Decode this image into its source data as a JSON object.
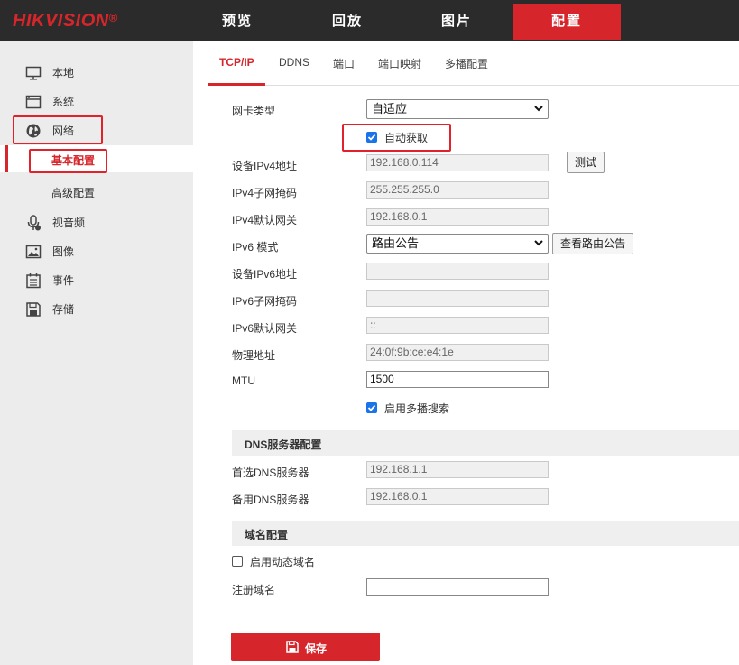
{
  "app": {
    "logo": "HIKVISION",
    "logo_mark": "®"
  },
  "topnav": {
    "items": [
      "预览",
      "回放",
      "图片",
      "配置"
    ],
    "active": "配置"
  },
  "sidebar": {
    "items": [
      {
        "label": "本地",
        "icon": "monitor-icon"
      },
      {
        "label": "系统",
        "icon": "window-icon"
      },
      {
        "label": "网络",
        "icon": "globe-icon"
      },
      {
        "label": "视音频",
        "icon": "microphone-icon"
      },
      {
        "label": "图像",
        "icon": "image-icon"
      },
      {
        "label": "事件",
        "icon": "calendar-icon"
      },
      {
        "label": "存储",
        "icon": "floppy-icon"
      }
    ],
    "network_sub": [
      {
        "label": "基本配置",
        "active": true
      },
      {
        "label": "高级配置",
        "active": false
      }
    ]
  },
  "tabs": {
    "items": [
      "TCP/IP",
      "DDNS",
      "端口",
      "端口映射",
      "多播配置"
    ],
    "active": "TCP/IP"
  },
  "form": {
    "nic_type_label": "网卡类型",
    "nic_type_value": "自适应",
    "dhcp_label": "自动获取",
    "dhcp_checked": true,
    "ipv4_addr_label": "设备IPv4地址",
    "ipv4_addr_value": "192.168.0.114",
    "test_button": "测试",
    "ipv4_mask_label": "IPv4子网掩码",
    "ipv4_mask_value": "255.255.255.0",
    "ipv4_gw_label": "IPv4默认网关",
    "ipv4_gw_value": "192.168.0.1",
    "ipv6_mode_label": "IPv6 模式",
    "ipv6_mode_value": "路由公告",
    "view_route_button": "查看路由公告",
    "ipv6_addr_label": "设备IPv6地址",
    "ipv6_addr_value": "",
    "ipv6_mask_label": "IPv6子网掩码",
    "ipv6_mask_value": "",
    "ipv6_gw_label": "IPv6默认网关",
    "ipv6_gw_value": "::",
    "mac_label": "物理地址",
    "mac_value": "24:0f:9b:ce:e4:1e",
    "mtu_label": "MTU",
    "mtu_value": "1500",
    "multicast_search_label": "启用多播搜索",
    "multicast_search_checked": true
  },
  "dns": {
    "section_title": "DNS服务器配置",
    "primary_label": "首选DNS服务器",
    "primary_value": "192.168.1.1",
    "secondary_label": "备用DNS服务器",
    "secondary_value": "192.168.0.1"
  },
  "domain": {
    "section_title": "域名配置",
    "ddns_enable_label": "启用动态域名",
    "ddns_enable_checked": false,
    "register_label": "注册域名",
    "register_value": ""
  },
  "actions": {
    "save_label": "保存"
  },
  "colors": {
    "accent": "#d7262b",
    "highlight_box": "#e3212b",
    "checkbox": "#1a73e8",
    "topbar": "#2b2b2b"
  }
}
